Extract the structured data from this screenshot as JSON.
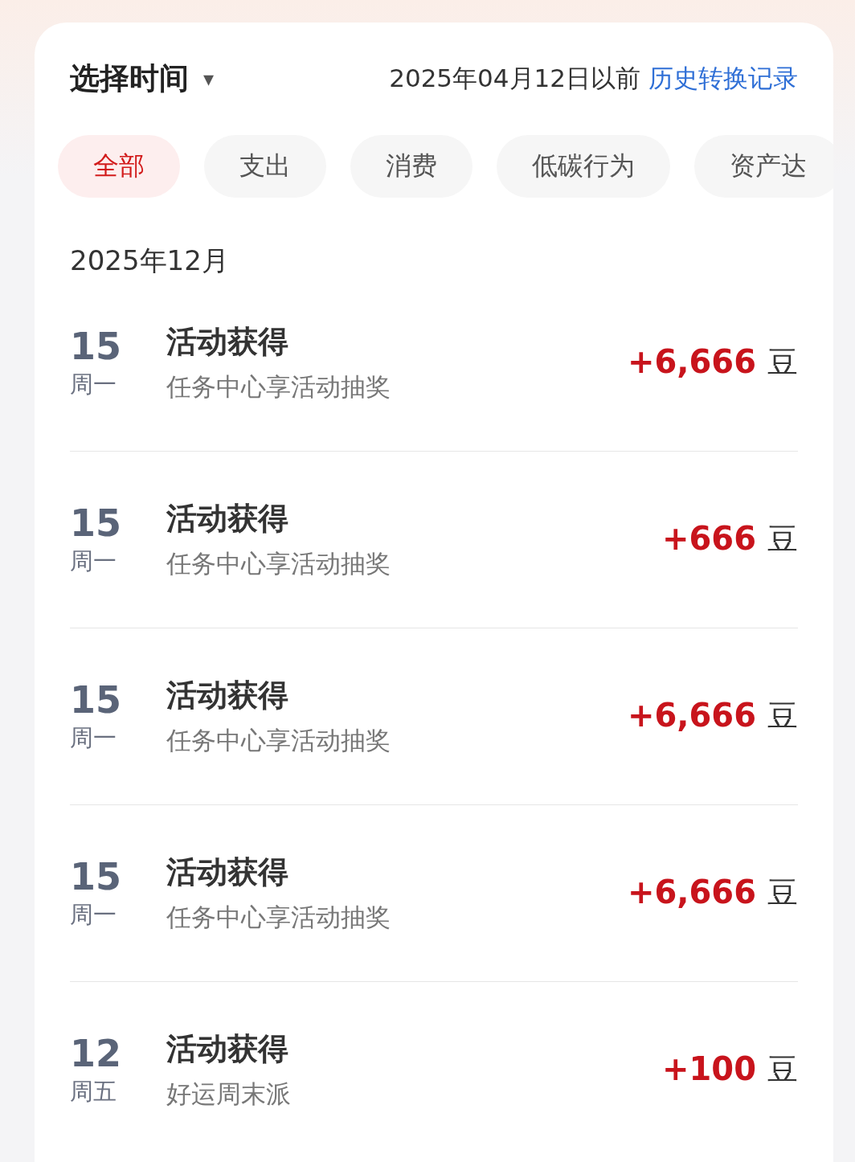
{
  "header": {
    "title": "选择时间",
    "caret": "▾",
    "date_note": "2025年04月12日以前",
    "history_link": "历史转换记录"
  },
  "tabs": [
    {
      "label": "全部",
      "selected": true
    },
    {
      "label": "支出",
      "selected": false
    },
    {
      "label": "消费",
      "selected": false
    },
    {
      "label": "低碳行为",
      "selected": false
    },
    {
      "label": "资产达",
      "selected": false
    }
  ],
  "month": "2025年12月",
  "records": [
    {
      "day": "15",
      "weekday": "周一",
      "title": "活动获得",
      "detail": "任务中心享活动抽奖",
      "amount": "+6,666",
      "unit": "豆"
    },
    {
      "day": "15",
      "weekday": "周一",
      "title": "活动获得",
      "detail": "任务中心享活动抽奖",
      "amount": "+666",
      "unit": "豆"
    },
    {
      "day": "15",
      "weekday": "周一",
      "title": "活动获得",
      "detail": "任务中心享活动抽奖",
      "amount": "+6,666",
      "unit": "豆"
    },
    {
      "day": "15",
      "weekday": "周一",
      "title": "活动获得",
      "detail": "任务中心享活动抽奖",
      "amount": "+6,666",
      "unit": "豆"
    },
    {
      "day": "12",
      "weekday": "周五",
      "title": "活动获得",
      "detail": "好运周末派",
      "amount": "+100",
      "unit": "豆"
    }
  ]
}
